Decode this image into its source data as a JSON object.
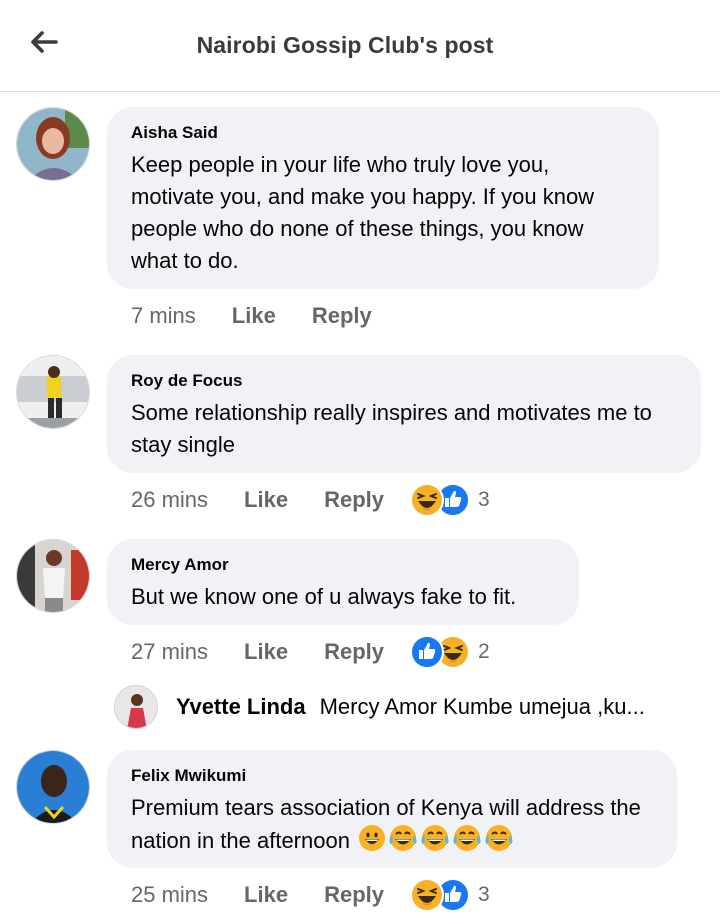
{
  "header": {
    "title": "Nairobi Gossip Club's post"
  },
  "comments": [
    {
      "author": "Aisha Said",
      "text": "Keep people in your life who truly love you, motivate you, and make you happy. If you know people who do none of these things, you know what to do.",
      "time": "7 mins",
      "like": "Like",
      "reply": "Reply"
    },
    {
      "author": "Roy de Focus",
      "text": "Some relationship really inspires and motivates me to stay single",
      "time": "26 mins",
      "like": "Like",
      "reply": "Reply",
      "reactions": {
        "icons": [
          "haha-icon",
          "like-icon"
        ],
        "count": "3"
      }
    },
    {
      "author": "Mercy Amor",
      "text": "But we know one of u always fake to fit.",
      "time": "27 mins",
      "like": "Like",
      "reply": "Reply",
      "reactions": {
        "icons": [
          "like-icon",
          "haha-icon"
        ],
        "count": "2"
      }
    },
    {
      "author": "Felix Mwikumi",
      "text": "Premium tears association of Kenya will address the nation in the afternoon",
      "emojis": [
        "grinning-face-icon",
        "tears-of-joy-icon",
        "tears-of-joy-icon",
        "tears-of-joy-icon",
        "tears-of-joy-icon"
      ],
      "time": "25 mins",
      "like": "Like",
      "reply": "Reply",
      "reactions": {
        "icons": [
          "haha-icon",
          "like-icon"
        ],
        "count": "3"
      }
    }
  ],
  "reply_preview": {
    "name": "Yvette Linda",
    "text": "Mercy Amor Kumbe umejua ,ku..."
  },
  "colors": {
    "bubble": "#f0f2f5",
    "like_blue": "#1877f2",
    "haha_yellow": "#f7b125",
    "meta_gray": "#65676b"
  }
}
